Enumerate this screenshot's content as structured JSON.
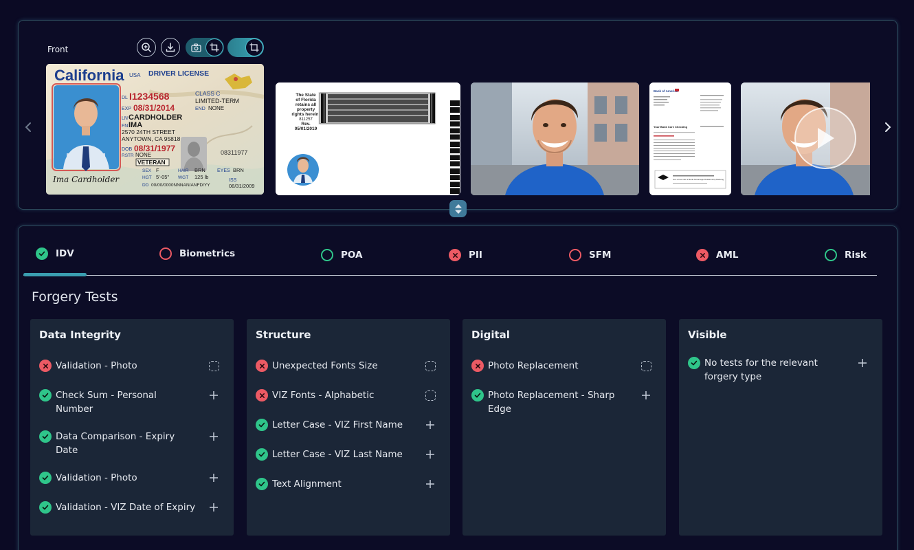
{
  "gallery": {
    "label": "Front",
    "id_card": {
      "state": "California",
      "country": "USA",
      "doc_type": "DRIVER LICENSE",
      "dl_label": "DL",
      "dl_number": "I1234568",
      "exp_label": "EXP",
      "exp": "08/31/2014",
      "ln_label": "LN",
      "last_name": "CARDHOLDER",
      "fn_label": "FN",
      "first_name": "IMA",
      "address_1": "2570 24TH STREET",
      "address_2": "ANYTOWN, CA 95818",
      "dob_label": "DOB",
      "dob": "08/31/1977",
      "rstr_label": "RSTR",
      "rstr": "NONE",
      "class": "CLASS C",
      "limited": "LIMITED-TERM",
      "end_label": "END",
      "end": "NONE",
      "side_number": "08311977",
      "veteran": "VETERAN",
      "sex_label": "SEX",
      "sex": "F",
      "hair_label": "HAIR",
      "hair": "BRN",
      "eyes_label": "EYES",
      "eyes": "BRN",
      "hgt_label": "HGT",
      "hgt": "5'-05\"",
      "wgt_label": "WGT",
      "wgt": "125 lb",
      "dd_label": "DD",
      "dd": "00/00/0000NNNAN/ANFD/YY",
      "iss_label": "ISS",
      "iss": "08/31/2009",
      "signature": "Ima Cardholder"
    },
    "back_card": {
      "l1": "The State",
      "l2": "of Florida",
      "l3": "retains all",
      "l4": "property",
      "l5": "rights herein.",
      "l6": "811257",
      "l7": "Rev.",
      "l8": "05/01/2019"
    },
    "doc_thumb": {
      "bank": "Bank of America",
      "heading": "Your Bank Core Checking",
      "foot": "Get a free trial of Bank Advantage Relationship Banking"
    }
  },
  "tabs": [
    {
      "label": "IDV",
      "status": "ok"
    },
    {
      "label": "Biometrics",
      "status": "ring-red"
    },
    {
      "label": "POA",
      "status": "ring-green"
    },
    {
      "label": "PII",
      "status": "fail"
    },
    {
      "label": "SFM",
      "status": "ring-red"
    },
    {
      "label": "AML",
      "status": "fail"
    },
    {
      "label": "Risk",
      "status": "ring-green"
    }
  ],
  "section_title": "Forgery Tests",
  "cards": [
    {
      "title": "Data Integrity",
      "items": [
        {
          "label": "Validation - Photo",
          "status": "fail",
          "action": "dashed"
        },
        {
          "label": "Check Sum - Personal Number",
          "status": "ok",
          "action": "plus"
        },
        {
          "label": "Data Comparison - Expiry Date",
          "status": "ok",
          "action": "plus"
        },
        {
          "label": "Validation - Photo",
          "status": "ok",
          "action": "plus"
        },
        {
          "label": "Validation - VIZ Date of Expiry",
          "status": "ok",
          "action": "plus"
        }
      ]
    },
    {
      "title": "Structure",
      "items": [
        {
          "label": "Unexpected Fonts Size",
          "status": "fail",
          "action": "dashed"
        },
        {
          "label": "VIZ Fonts - Alphabetic",
          "status": "fail",
          "action": "dashed"
        },
        {
          "label": "Letter Case - VIZ First Name",
          "status": "ok",
          "action": "plus"
        },
        {
          "label": "Letter Case - VIZ Last Name",
          "status": "ok",
          "action": "plus"
        },
        {
          "label": "Text Alignment",
          "status": "ok",
          "action": "plus"
        }
      ]
    },
    {
      "title": "Digital",
      "items": [
        {
          "label": "Photo Replacement",
          "status": "fail",
          "action": "dashed"
        },
        {
          "label": "Photo Replacement - Sharp Edge",
          "status": "ok",
          "action": "plus"
        }
      ]
    },
    {
      "title": "Visible",
      "items": [
        {
          "label": "No tests for the relevant forgery type",
          "status": "ok",
          "action": "plus"
        }
      ]
    }
  ],
  "colors": {
    "ok": "#2fc58a",
    "fail": "#ec5a64",
    "accent": "#3a9eb0",
    "card_bg": "#1b2637",
    "page_bg": "#0b0a24"
  },
  "icons": {
    "zoom": "zoom-in-icon",
    "download": "download-icon",
    "camera": "camera-icon",
    "crop": "crop-icon",
    "frame": "frame-icon",
    "prev": "chevron-left-icon",
    "next": "chevron-right-icon",
    "play": "play-icon",
    "collapse": "collapse-toggle-icon"
  }
}
